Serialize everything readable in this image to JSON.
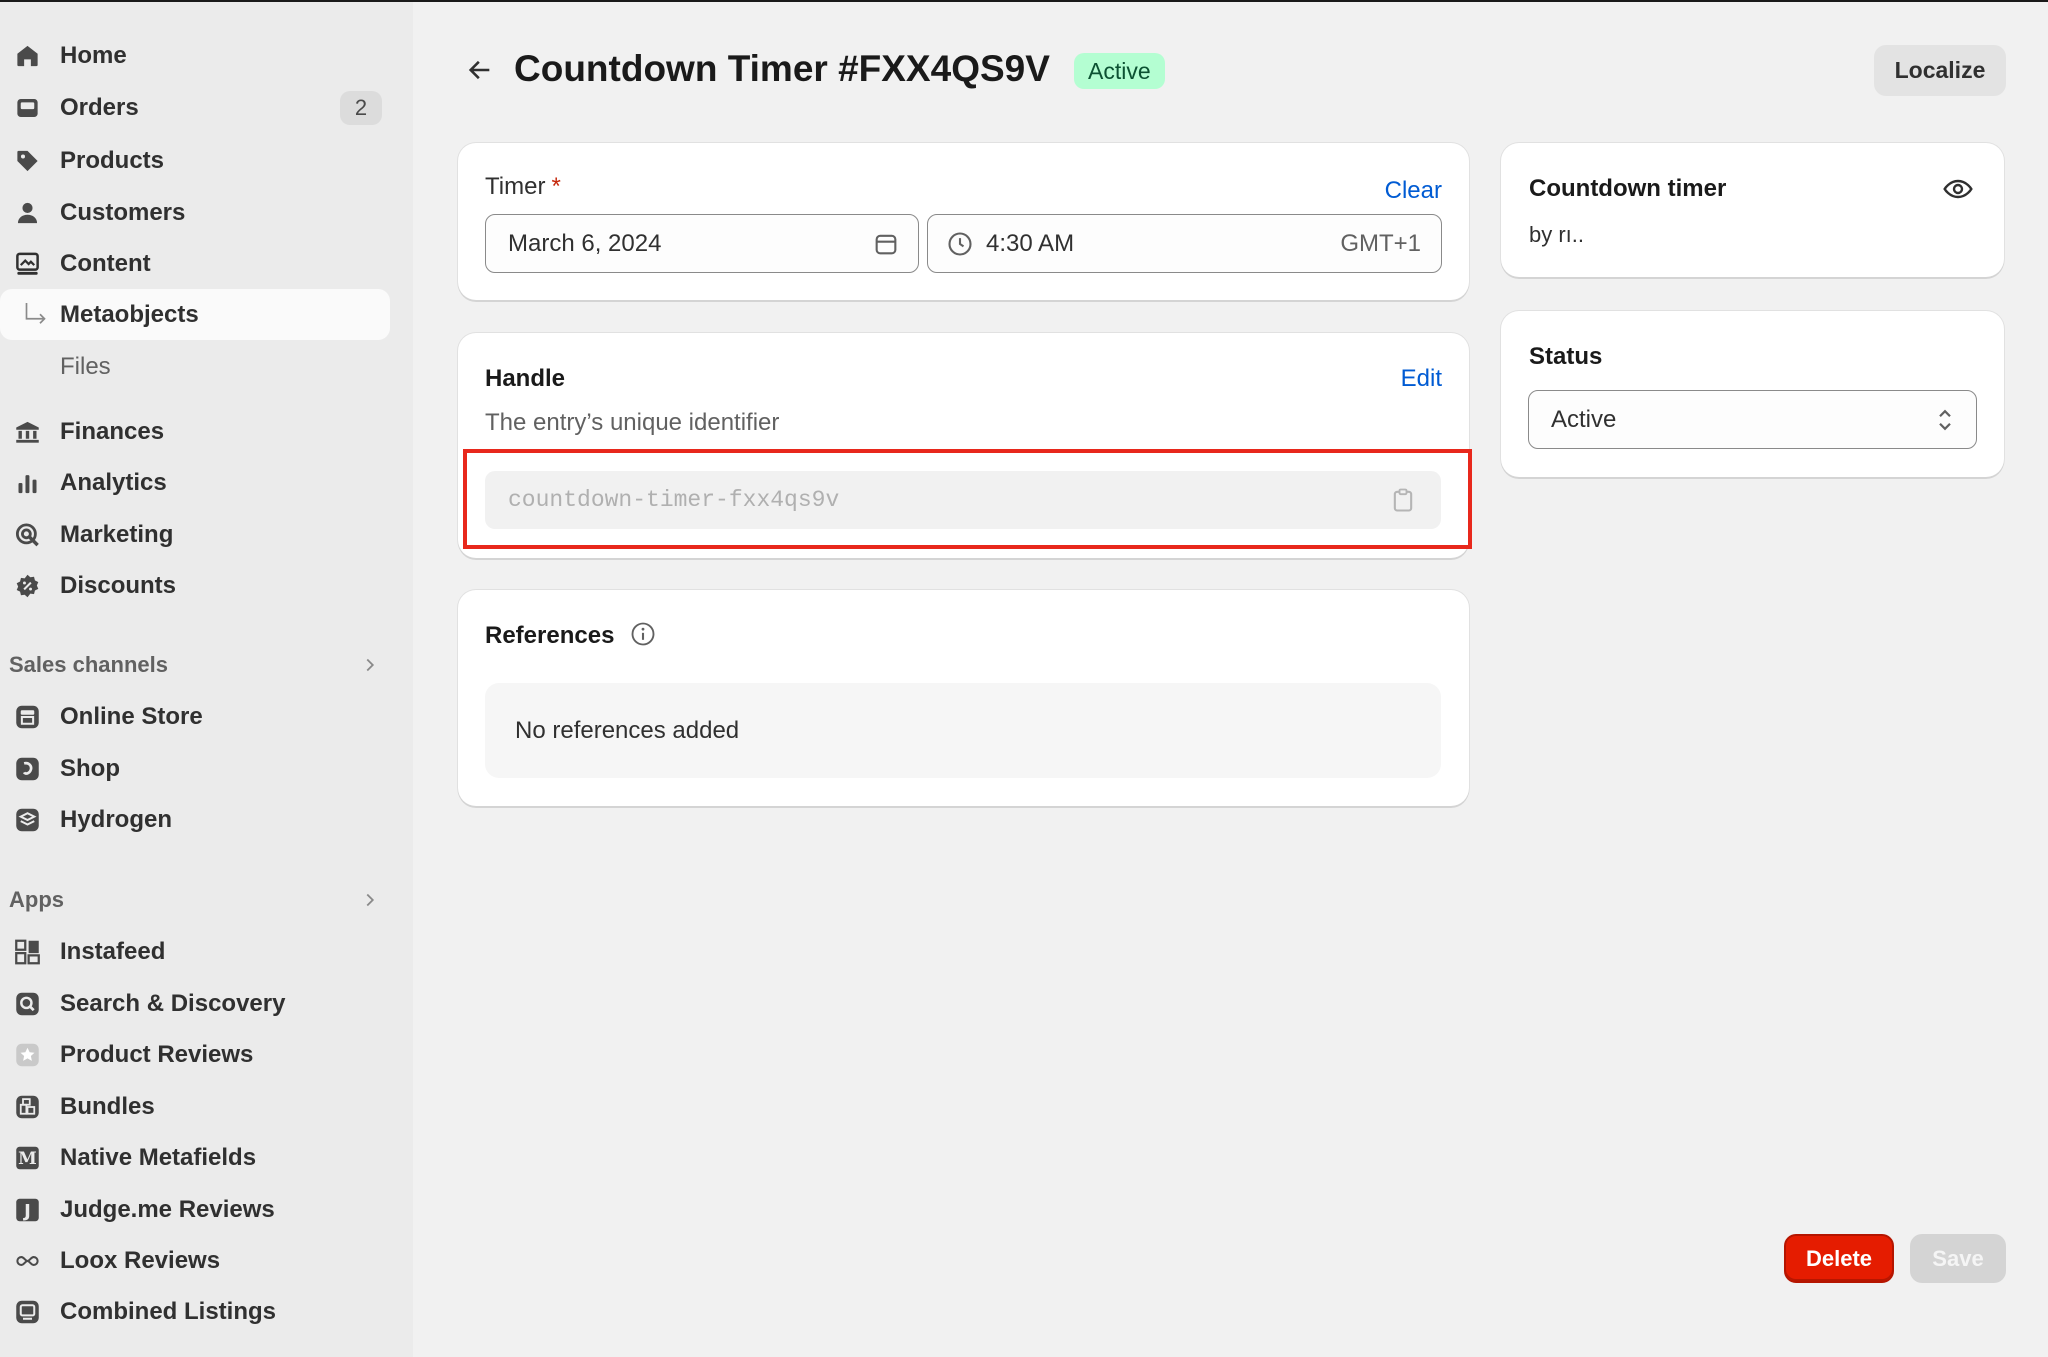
{
  "sidebar": {
    "items": [
      {
        "label": "Home",
        "icon": "home-icon"
      },
      {
        "label": "Orders",
        "icon": "orders-icon",
        "badge": "2"
      },
      {
        "label": "Products",
        "icon": "tag-icon"
      },
      {
        "label": "Customers",
        "icon": "person-icon"
      },
      {
        "label": "Content",
        "icon": "content-icon"
      },
      {
        "label": "Metaobjects",
        "icon": "subitem-arrow-icon",
        "selected": true
      },
      {
        "label": "Files"
      },
      {
        "label": "Finances",
        "icon": "bank-icon"
      },
      {
        "label": "Analytics",
        "icon": "bar-chart-icon"
      },
      {
        "label": "Marketing",
        "icon": "marketing-target-icon"
      },
      {
        "label": "Discounts",
        "icon": "discount-icon"
      }
    ],
    "sales_channels": {
      "heading": "Sales channels",
      "items": [
        {
          "label": "Online Store",
          "icon": "store-icon"
        },
        {
          "label": "Shop",
          "icon": "shop-icon"
        },
        {
          "label": "Hydrogen",
          "icon": "hydrogen-icon"
        }
      ]
    },
    "apps": {
      "heading": "Apps",
      "items": [
        {
          "label": "Instafeed",
          "icon": "grid-icon"
        },
        {
          "label": "Search & Discovery",
          "icon": "search-icon"
        },
        {
          "label": "Product Reviews",
          "icon": "star-icon"
        },
        {
          "label": "Bundles",
          "icon": "bundles-icon"
        },
        {
          "label": "Native Metafields",
          "icon": "letter-m-icon"
        },
        {
          "label": "Judge.me Reviews",
          "icon": "letter-j-icon"
        },
        {
          "label": "Loox Reviews",
          "icon": "infinity-icon"
        },
        {
          "label": "Combined Listings",
          "icon": "listings-icon"
        }
      ]
    }
  },
  "header": {
    "title": "Countdown Timer #FXX4QS9V",
    "status": "Active",
    "localize_label": "Localize"
  },
  "timer_card": {
    "label": "Timer",
    "required_mark": "*",
    "clear_label": "Clear",
    "date_value": "March 6, 2024",
    "time_value": "4:30 AM",
    "timezone": "GMT+1"
  },
  "handle_card": {
    "label": "Handle",
    "edit_label": "Edit",
    "description": "The entry’s unique identifier",
    "value": "countdown-timer-fxx4qs9v"
  },
  "references_card": {
    "label": "References",
    "empty_text": "No references added"
  },
  "definition_card": {
    "title": "Countdown timer",
    "byline": "by rı.."
  },
  "status_card": {
    "label": "Status",
    "selected": "Active"
  },
  "footer": {
    "delete_label": "Delete",
    "save_label": "Save"
  },
  "colors": {
    "accent_link": "#005bd3",
    "active_badge_bg": "#b4fed2",
    "delete_button": "#e51c00",
    "highlight_box": "#e8281c"
  }
}
